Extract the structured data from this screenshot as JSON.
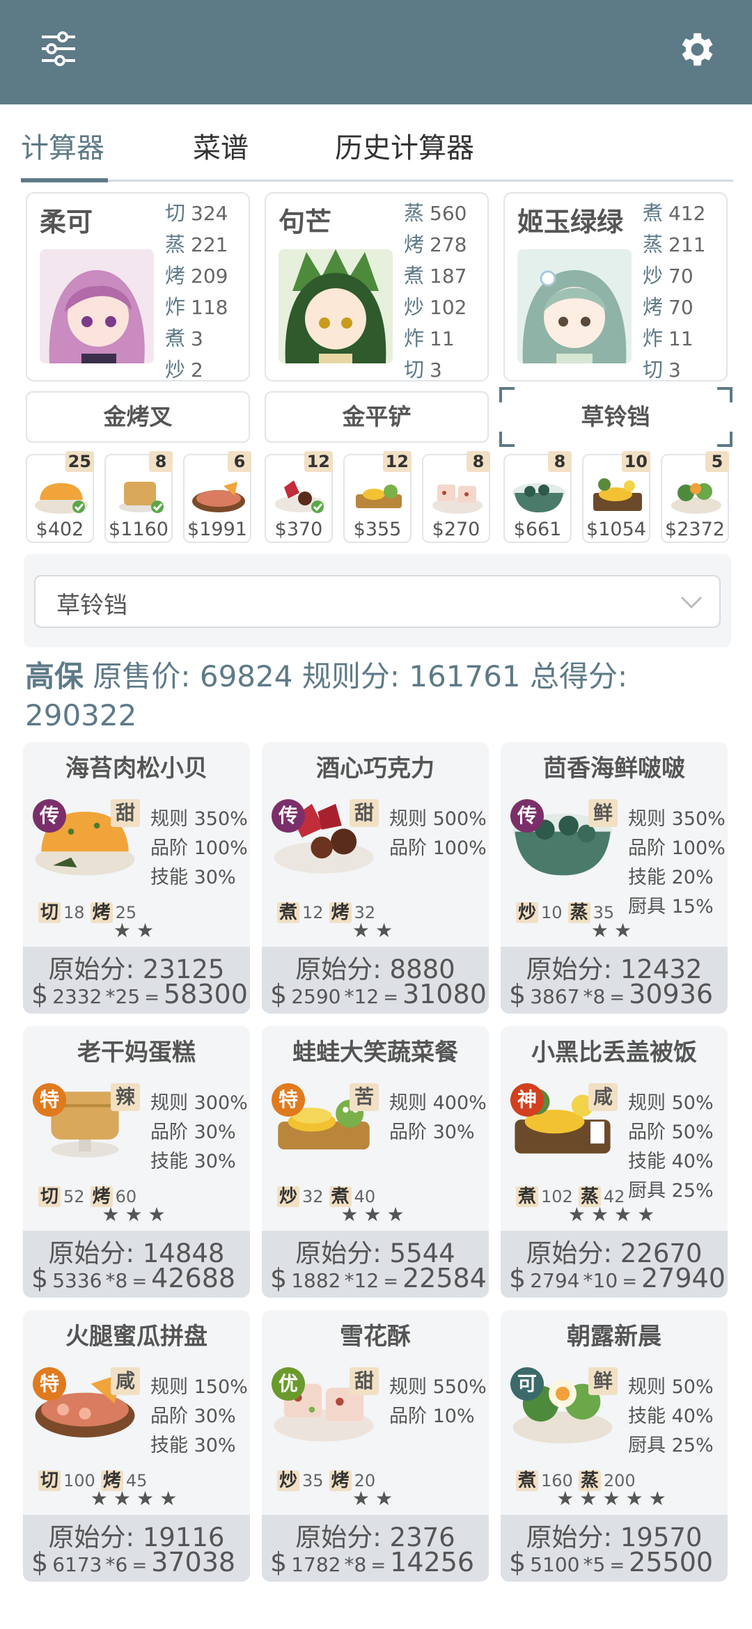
{
  "colors": {
    "primary": "#5d7a87",
    "tag": "#f1e0c4",
    "card": "#f3f5f7"
  },
  "header": {
    "left_icon": "tune-icon",
    "right_icon": "gear-icon"
  },
  "tabs": [
    {
      "label": "计算器",
      "active": true
    },
    {
      "label": "菜谱",
      "active": false
    },
    {
      "label": "历史计算器",
      "active": false
    }
  ],
  "chefs": [
    {
      "name": "柔可",
      "stats": [
        {
          "k": "切",
          "v": "324"
        },
        {
          "k": "蒸",
          "v": "221"
        },
        {
          "k": "烤",
          "v": "209"
        },
        {
          "k": "炸",
          "v": "118"
        },
        {
          "k": "煮",
          "v": "3"
        },
        {
          "k": "炒",
          "v": "2"
        }
      ]
    },
    {
      "name": "句芒",
      "stats": [
        {
          "k": "蒸",
          "v": "560"
        },
        {
          "k": "烤",
          "v": "278"
        },
        {
          "k": "煮",
          "v": "187"
        },
        {
          "k": "炒",
          "v": "102"
        },
        {
          "k": "炸",
          "v": "11"
        },
        {
          "k": "切",
          "v": "3"
        }
      ]
    },
    {
      "name": "姬玉绿绿",
      "stats": [
        {
          "k": "煮",
          "v": "412"
        },
        {
          "k": "蒸",
          "v": "211"
        },
        {
          "k": "炒",
          "v": "70"
        },
        {
          "k": "烤",
          "v": "70"
        },
        {
          "k": "炸",
          "v": "11"
        },
        {
          "k": "切",
          "v": "3"
        }
      ]
    }
  ],
  "equipment": [
    {
      "label": "金烤叉"
    },
    {
      "label": "金平铲"
    },
    {
      "label": "草铃铛"
    }
  ],
  "mini_dishes": [
    {
      "count": "25",
      "price": "$402"
    },
    {
      "count": "8",
      "price": "$1160"
    },
    {
      "count": "6",
      "price": "$1991"
    },
    {
      "count": "12",
      "price": "$370"
    },
    {
      "count": "12",
      "price": "$355"
    },
    {
      "count": "8",
      "price": "$270"
    },
    {
      "count": "8",
      "price": "$661"
    },
    {
      "count": "10",
      "price": "$1054"
    },
    {
      "count": "5",
      "price": "$2372"
    }
  ],
  "select": {
    "value": "草铃铛"
  },
  "summary": {
    "label": "高保",
    "text": " 原售价:  69824 规则分:  161761 总得分:  290322"
  },
  "cards": [
    {
      "title": "海苔肉松小贝",
      "badge": "传",
      "flavor": "甜",
      "rules": [
        "规则 350%",
        "品阶 100%",
        "技能 30%"
      ],
      "req": [
        {
          "k": "切",
          "v": "18"
        },
        {
          "k": "烤",
          "v": "25"
        }
      ],
      "stars": "★★",
      "orig": "原始分: 23125",
      "price": "2332",
      "mult": "*25",
      "eq": "=",
      "total": "58300"
    },
    {
      "title": "酒心巧克力",
      "badge": "传",
      "flavor": "甜",
      "rules": [
        "规则 500%",
        "品阶 100%"
      ],
      "req": [
        {
          "k": "煮",
          "v": "12"
        },
        {
          "k": "烤",
          "v": "32"
        }
      ],
      "stars": "★★",
      "orig": "原始分: 8880",
      "price": "2590",
      "mult": "*12",
      "eq": "=",
      "total": "31080"
    },
    {
      "title": "茴香海鲜啵啵",
      "badge": "传",
      "flavor": "鲜",
      "rules": [
        "规则 350%",
        "品阶 100%",
        "技能 20%",
        "厨具 15%"
      ],
      "req": [
        {
          "k": "炒",
          "v": "10"
        },
        {
          "k": "蒸",
          "v": "35"
        }
      ],
      "stars": "★★",
      "orig": "原始分: 12432",
      "price": "3867",
      "mult": "*8",
      "eq": "=",
      "total": "30936"
    },
    {
      "title": "老干妈蛋糕",
      "badge": "特",
      "flavor": "辣",
      "rules": [
        "规则 300%",
        "品阶 30%",
        "技能 30%"
      ],
      "req": [
        {
          "k": "切",
          "v": "52"
        },
        {
          "k": "烤",
          "v": "60"
        }
      ],
      "stars": "★★★",
      "orig": "原始分: 14848",
      "price": "5336",
      "mult": "*8",
      "eq": "=",
      "total": "42688"
    },
    {
      "title": "蛙蛙大笑蔬菜餐",
      "badge": "特",
      "flavor": "苦",
      "rules": [
        "规则 400%",
        "品阶 30%"
      ],
      "req": [
        {
          "k": "炒",
          "v": "32"
        },
        {
          "k": "煮",
          "v": "40"
        }
      ],
      "stars": "★★★",
      "orig": "原始分: 5544",
      "price": "1882",
      "mult": "*12",
      "eq": "=",
      "total": "22584"
    },
    {
      "title": "小黑比丢盖被饭",
      "badge": "神",
      "flavor": "咸",
      "rules": [
        "规则 50%",
        "品阶 50%",
        "技能 40%",
        "厨具 25%"
      ],
      "req": [
        {
          "k": "煮",
          "v": "102"
        },
        {
          "k": "蒸",
          "v": "42"
        }
      ],
      "stars": "★★★★",
      "orig": "原始分: 22670",
      "price": "2794",
      "mult": "*10",
      "eq": "=",
      "total": "27940"
    },
    {
      "title": "火腿蜜瓜拼盘",
      "badge": "特",
      "flavor": "咸",
      "rules": [
        "规则 150%",
        "品阶 30%",
        "技能 30%"
      ],
      "req": [
        {
          "k": "切",
          "v": "100"
        },
        {
          "k": "烤",
          "v": "45"
        }
      ],
      "stars": "★★★★",
      "orig": "原始分: 19116",
      "price": "6173",
      "mult": "*6",
      "eq": "=",
      "total": "37038"
    },
    {
      "title": "雪花酥",
      "badge": "优",
      "flavor": "甜",
      "rules": [
        "规则 550%",
        "品阶 10%"
      ],
      "req": [
        {
          "k": "炒",
          "v": "35"
        },
        {
          "k": "烤",
          "v": "20"
        }
      ],
      "stars": "★★",
      "orig": "原始分: 2376",
      "price": "1782",
      "mult": "*8",
      "eq": "=",
      "total": "14256"
    },
    {
      "title": "朝露新晨",
      "badge": "可",
      "flavor": "鲜",
      "rules": [
        "规则 50%",
        "技能 40%",
        "厨具 25%"
      ],
      "req": [
        {
          "k": "煮",
          "v": "160"
        },
        {
          "k": "蒸",
          "v": "200"
        }
      ],
      "stars": "★★★★★",
      "orig": "原始分: 19570",
      "price": "5100",
      "mult": "*5",
      "eq": "=",
      "total": "25500"
    }
  ]
}
